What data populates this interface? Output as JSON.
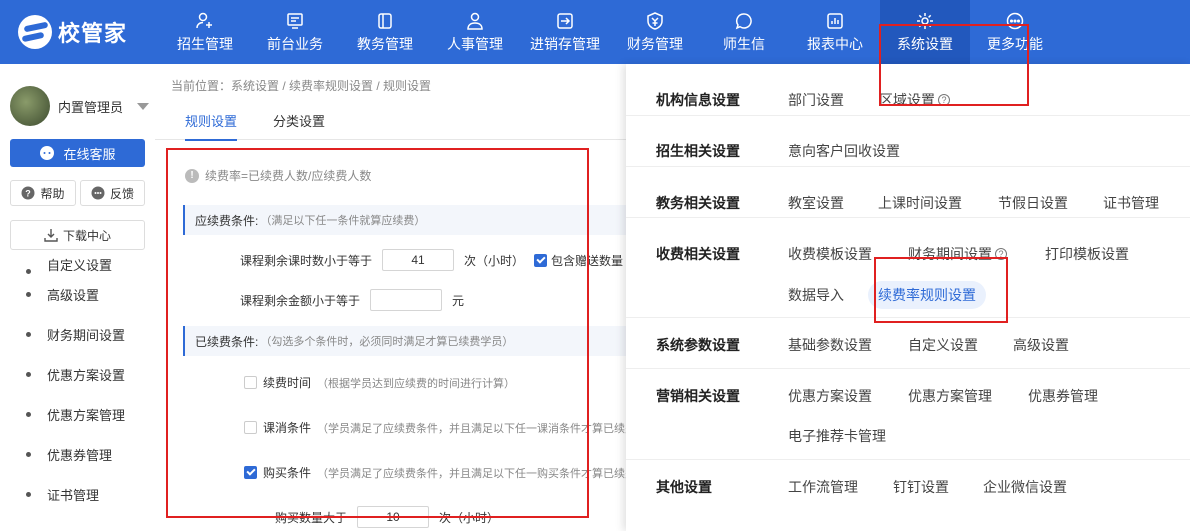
{
  "app": {
    "logo_text": "校管家"
  },
  "nav": {
    "items": [
      {
        "label": "招生管理",
        "icon": "user-plus-icon"
      },
      {
        "label": "前台业务",
        "icon": "monitor-icon"
      },
      {
        "label": "教务管理",
        "icon": "book-icon"
      },
      {
        "label": "人事管理",
        "icon": "person-icon"
      },
      {
        "label": "进销存管理",
        "icon": "enter-box-icon"
      },
      {
        "label": "财务管理",
        "icon": "yuan-shield-icon"
      },
      {
        "label": "师生信",
        "icon": "chat-icon"
      },
      {
        "label": "报表中心",
        "icon": "bar-chart-icon"
      },
      {
        "label": "系统设置",
        "icon": "gear-icon"
      },
      {
        "label": "更多功能",
        "icon": "more-icon"
      }
    ],
    "active": "系统设置"
  },
  "sidebar": {
    "user_name": "内置管理员",
    "online_service": "在线客服",
    "help": "帮助",
    "feedback": "反馈",
    "download_center": "下载中心",
    "items": [
      "自定义设置",
      "高级设置",
      "财务期间设置",
      "优惠方案设置",
      "优惠方案管理",
      "优惠券管理",
      "证书管理"
    ]
  },
  "main": {
    "breadcrumb": "当前位置：系统设置 / 续费率规则设置 / 规则设置",
    "tabs": [
      "规则设置",
      "分类设置"
    ],
    "formula": "续费率=已续费人数/应续费人数",
    "should_renew": {
      "title": "应续费条件:",
      "hint": "（满足以下任一条件就算应续费）",
      "remaining_hours_label": "课程剩余课时数小于等于",
      "remaining_hours_value": "41",
      "remaining_hours_unit": "次（小时）",
      "include_gift_label": "包含赠送数量",
      "remaining_amount_label": "课程剩余金额小于等于",
      "remaining_amount_value": "",
      "remaining_amount_unit": "元"
    },
    "renewed": {
      "title": "已续费条件:",
      "hint": "（勾选多个条件时，必须同时满足才算已续费学员）",
      "time_label": "续费时间",
      "time_hint": "（根据学员达到应续费的时间进行计算）",
      "consume_label": "课消条件",
      "consume_hint": "（学员满足了应续费条件，并且满足以下任一课消条件才算已续费",
      "purchase_label": "购买条件",
      "purchase_hint": "（学员满足了应续费条件，并且满足以下任一购买条件才算已续费",
      "purchase_qty_label": "购买数量大于",
      "purchase_qty_value": "10",
      "purchase_qty_unit": "次（小时）"
    }
  },
  "panel": {
    "groups": [
      {
        "title": "机构信息设置",
        "items": [
          "部门设置",
          "区域设置"
        ]
      },
      {
        "title": "招生相关设置",
        "items": [
          "意向客户回收设置"
        ]
      },
      {
        "title": "教务相关设置",
        "items": [
          "教室设置",
          "上课时间设置",
          "节假日设置",
          "证书管理"
        ]
      },
      {
        "title": "收费相关设置",
        "items": [
          "收费模板设置",
          "财务期间设置",
          "打印模板设置",
          "数据导入",
          "续费率规则设置"
        ]
      },
      {
        "title": "系统参数设置",
        "items": [
          "基础参数设置",
          "自定义设置",
          "高级设置"
        ]
      },
      {
        "title": "营销相关设置",
        "items": [
          "优惠方案设置",
          "优惠方案管理",
          "优惠券管理",
          "电子推荐卡管理"
        ]
      },
      {
        "title": "其他设置",
        "items": [
          "工作流管理",
          "钉钉设置",
          "企业微信设置"
        ]
      }
    ]
  },
  "colors": {
    "primary": "#2e6ad6",
    "annotation": "#e02020"
  }
}
